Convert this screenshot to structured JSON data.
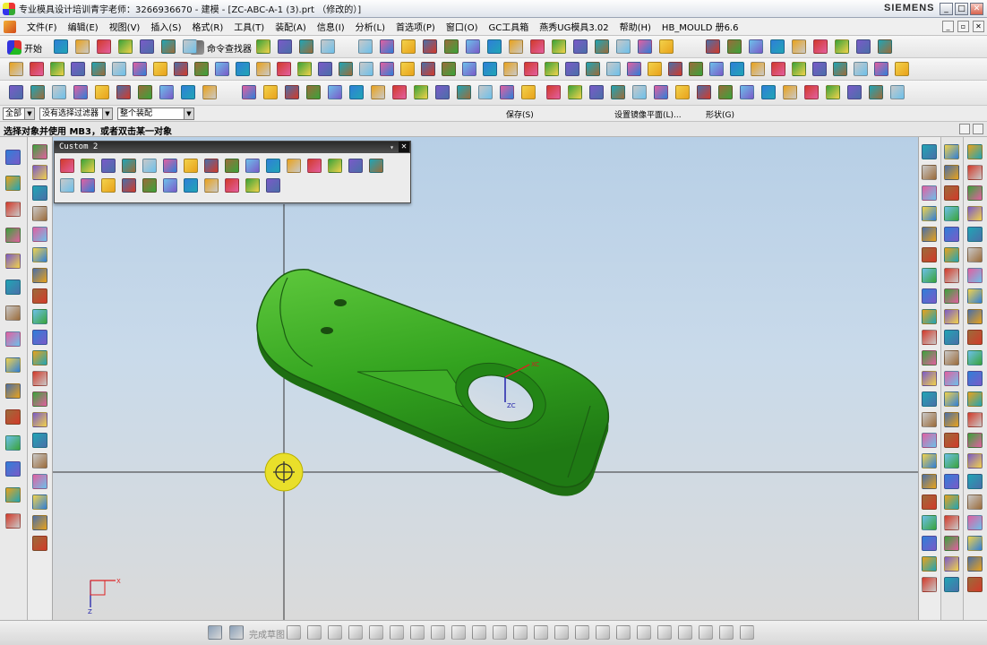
{
  "titlebar": {
    "title": "专业模具设计培训青宇老师：3266936670 - 建模 - [ZC-ABC-A-1 (3).prt （修改的）]",
    "brand": "SIEMENS",
    "minimize": "_",
    "restore": "□",
    "close": "✕"
  },
  "menubar": {
    "items": [
      "文件(F)",
      "编辑(E)",
      "视图(V)",
      "插入(S)",
      "格式(R)",
      "工具(T)",
      "装配(A)",
      "信息(I)",
      "分析(L)",
      "首选项(P)",
      "窗口(O)",
      "GC工具箱",
      "燕秀UG模具3.02",
      "帮助(H)",
      "HB_MOULD 册6.6"
    ]
  },
  "toolbar1": {
    "start_label": "开始",
    "command_finder_label": "命令查找器"
  },
  "filterbar": {
    "filter_scope": "全部",
    "type_filter": "没有选择过滤器",
    "assembly_scope": "整个装配",
    "save_label": "保存(S)",
    "mirror_plane_label": "设置镜像平面(L)...",
    "shape_label": "形状(G)"
  },
  "cue_line": "选择对象并使用 MB3，或者双击某一对象",
  "palette": {
    "title": "Custom 2",
    "menu_arrow": "▾",
    "close": "✕"
  },
  "viewport": {
    "axis_labels": {
      "xc": "XC",
      "zc": "ZC",
      "triad_x": "X",
      "triad_z": "Z"
    }
  },
  "sketch_bar": {
    "finish_label": "完成草图"
  },
  "colors": {
    "part": "#33a31f",
    "part_dark": "#1c6e12",
    "part_highlight": "#7ddb55",
    "background_top": "#b7cfe6",
    "background_bottom": "#dadada"
  },
  "icons": {
    "app": "nx-app-icon",
    "start": "start-icon",
    "save": "save-icon",
    "undo": "undo-icon",
    "redo": "redo-icon",
    "snap_view": "wcs-icon"
  }
}
